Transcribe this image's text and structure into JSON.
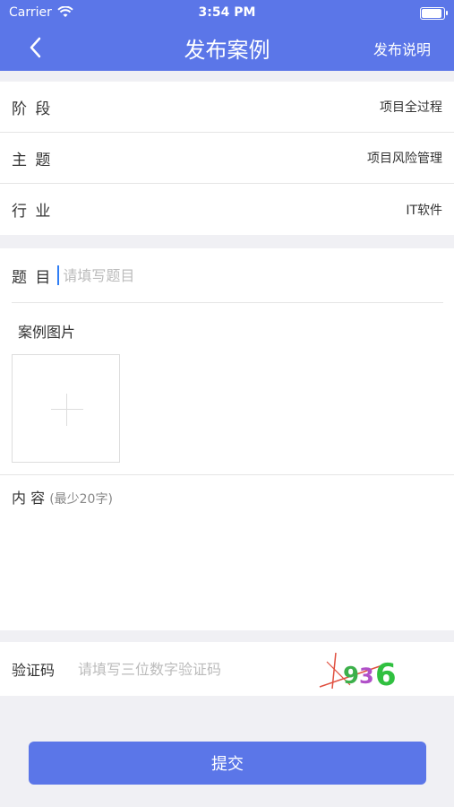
{
  "status_bar": {
    "carrier": "Carrier",
    "time": "3:54 PM"
  },
  "nav": {
    "title": "发布案例",
    "help_label": "发布说明"
  },
  "info_rows": [
    {
      "label": "阶 段",
      "value": "项目全过程"
    },
    {
      "label": "主 题",
      "value": "项目风险管理"
    },
    {
      "label": "行 业",
      "value": "IT软件"
    }
  ],
  "form": {
    "title_label": "题 目",
    "title_placeholder": "请填写题目",
    "images_label": "案例图片",
    "content_label": "内 容",
    "content_hint": "(最少20字)"
  },
  "captcha": {
    "label": "验证码",
    "placeholder": "请填写三位数字验证码",
    "code_digits": [
      "9",
      "3",
      "6"
    ]
  },
  "submit_label": "提交",
  "colors": {
    "primary": "#5b76e8",
    "caret": "#2f7ef5"
  }
}
